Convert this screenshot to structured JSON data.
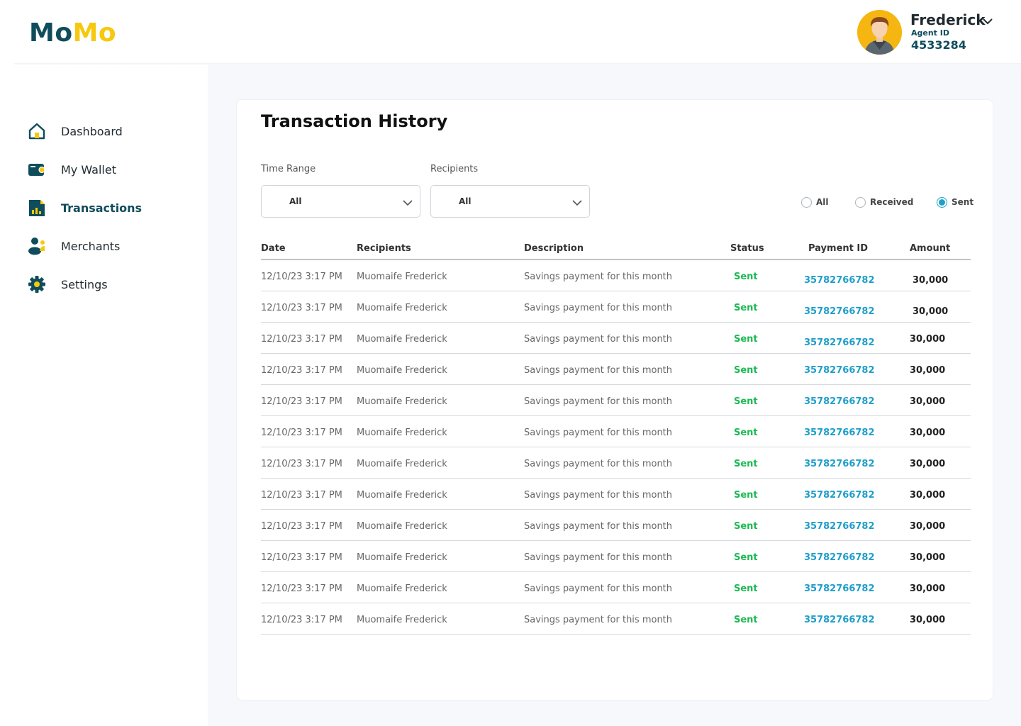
{
  "app": {
    "logo_part1": "Mo",
    "logo_part2": "Mo"
  },
  "profile": {
    "name": "Frederick",
    "agent_label": "Agent ID",
    "agent_id": "4533284",
    "avatar_icon": "user-avatar"
  },
  "sidebar": {
    "items": [
      {
        "label": "Dashboard",
        "icon": "home-icon",
        "active": false
      },
      {
        "label": "My Wallet",
        "icon": "wallet-icon",
        "active": false
      },
      {
        "label": "Transactions",
        "icon": "transactions-icon",
        "active": true
      },
      {
        "label": "Merchants",
        "icon": "merchants-icon",
        "active": false
      },
      {
        "label": "Settings",
        "icon": "gear-icon",
        "active": false
      }
    ]
  },
  "page": {
    "title": "Transaction History"
  },
  "filters": {
    "time_range_label": "Time Range",
    "time_range_value": "All",
    "recipients_label": "Recipients",
    "recipients_value": "All",
    "radio_options": [
      {
        "label": "All",
        "checked": false
      },
      {
        "label": "Received",
        "checked": false
      },
      {
        "label": "Sent",
        "checked": true
      }
    ]
  },
  "table": {
    "headers": [
      "Date",
      "Recipients",
      "Description",
      "Status",
      "Payment ID",
      "Amount"
    ],
    "rows": [
      {
        "date": "12/10/23  3:17 PM",
        "recipient": "Muomaife Frederick",
        "description": "Savings payment for this month",
        "status": "Sent",
        "payment_id": "35782766782",
        "amount": "30,000"
      },
      {
        "date": "12/10/23  3:17 PM",
        "recipient": "Muomaife Frederick",
        "description": "Savings payment for this month",
        "status": "Sent",
        "payment_id": "35782766782",
        "amount": "30,000"
      },
      {
        "date": "12/10/23  3:17 PM",
        "recipient": "Muomaife Frederick",
        "description": "Savings payment for this month",
        "status": "Sent",
        "payment_id": "35782766782",
        "amount": "30,000"
      },
      {
        "date": "12/10/23  3:17 PM",
        "recipient": "Muomaife Frederick",
        "description": "Savings payment for this month",
        "status": "Sent",
        "payment_id": "35782766782",
        "amount": "30,000"
      },
      {
        "date": "12/10/23  3:17 PM",
        "recipient": "Muomaife Frederick",
        "description": "Savings payment for this month",
        "status": "Sent",
        "payment_id": "35782766782",
        "amount": "30,000"
      },
      {
        "date": "12/10/23  3:17 PM",
        "recipient": "Muomaife Frederick",
        "description": "Savings payment for this month",
        "status": "Sent",
        "payment_id": "35782766782",
        "amount": "30,000"
      },
      {
        "date": "12/10/23  3:17 PM",
        "recipient": "Muomaife Frederick",
        "description": "Savings payment for this month",
        "status": "Sent",
        "payment_id": "35782766782",
        "amount": "30,000"
      },
      {
        "date": "12/10/23  3:17 PM",
        "recipient": "Muomaife Frederick",
        "description": "Savings payment for this month",
        "status": "Sent",
        "payment_id": "35782766782",
        "amount": "30,000"
      },
      {
        "date": "12/10/23  3:17 PM",
        "recipient": "Muomaife Frederick",
        "description": "Savings payment for this month",
        "status": "Sent",
        "payment_id": "35782766782",
        "amount": "30,000"
      },
      {
        "date": "12/10/23  3:17 PM",
        "recipient": "Muomaife Frederick",
        "description": "Savings payment for this month",
        "status": "Sent",
        "payment_id": "35782766782",
        "amount": "30,000"
      },
      {
        "date": "12/10/23  3:17 PM",
        "recipient": "Muomaife Frederick",
        "description": "Savings payment for this month",
        "status": "Sent",
        "payment_id": "35782766782",
        "amount": "30,000"
      },
      {
        "date": "12/10/23  3:17 PM",
        "recipient": "Muomaife Frederick",
        "description": "Savings payment for this month",
        "status": "Sent",
        "payment_id": "35782766782",
        "amount": "30,000"
      }
    ]
  },
  "colors": {
    "brand_dark": "#0f4c5c",
    "brand_yellow": "#f6c90e",
    "status_sent": "#1db954",
    "link_blue": "#1e9ecb"
  }
}
